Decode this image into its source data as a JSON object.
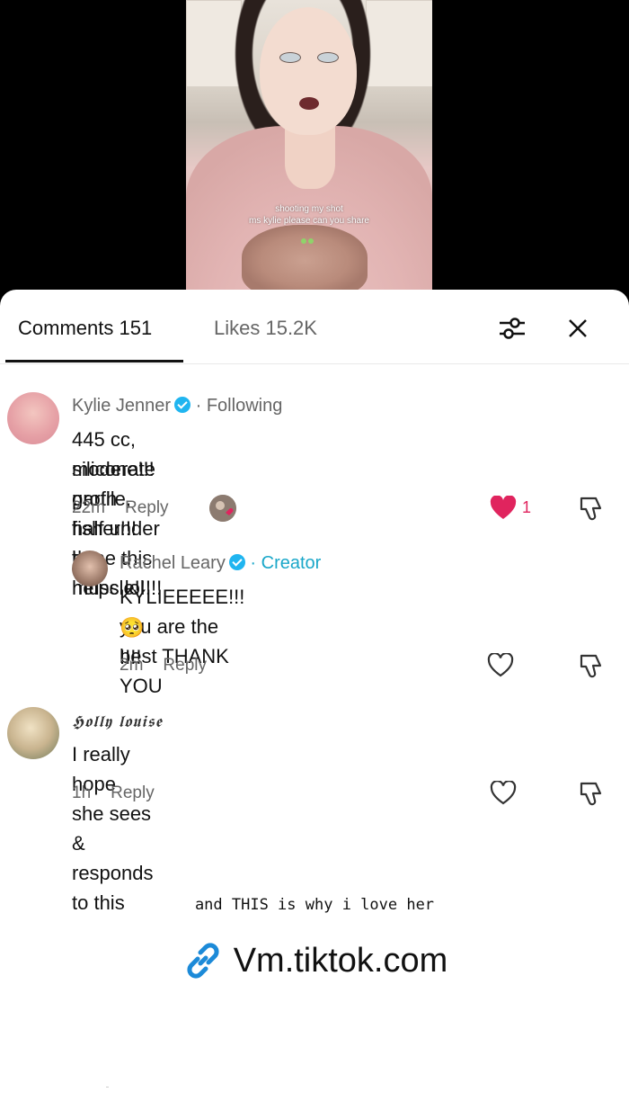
{
  "video": {
    "caption_line1": "shooting my shot",
    "caption_line2": "ms kylie please can you share"
  },
  "tabs": {
    "comments_label": "Comments 151",
    "likes_label": "Likes 15.2K"
  },
  "comments": [
    {
      "author": "Kylie Jenner",
      "verified": true,
      "relation": "· Following",
      "text_line1": "445 cc, moderate profile, half under the muscle!!!!!",
      "text_line2": "silicone!!! garth fisher!!! hope this helps lol",
      "time": "22m",
      "reply_label": "Reply",
      "like_count": "1",
      "liked": true
    },
    {
      "author": "Rachel Leary",
      "verified": true,
      "relation": "· Creator",
      "text_line1": "KYLIEEEEE!!! you are the best THANK YOU",
      "text_line2": "🥺 !!!!",
      "time": "2m",
      "reply_label": "Reply"
    },
    {
      "author": "𝕳𝖔𝖑𝖑𝖞 𝖑𝖔𝖚𝖎𝖘𝖊",
      "text_line1": "I really hope she sees & responds to this",
      "time": "1h",
      "reply_label": "Reply"
    }
  ],
  "footer": {
    "caption": "and THIS is why i love her",
    "link_text": "Vm.tiktok.com"
  },
  "colors": {
    "verified": "#20b5f0",
    "creator": "#1aa7c9",
    "like": "#e0245e",
    "link_icon": "#1c8ad8"
  },
  "icons": [
    "filter-sliders-icon",
    "close-icon",
    "verified-badge-icon",
    "heart-icon",
    "dislike-icon",
    "link-icon"
  ]
}
